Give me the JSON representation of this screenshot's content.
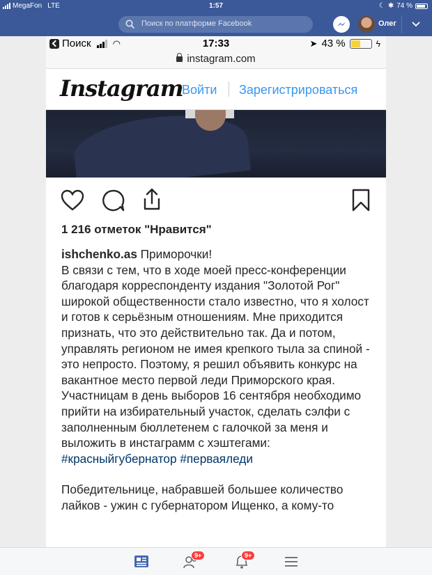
{
  "ipad_status": {
    "carrier": "MegaFon",
    "network": "LTE",
    "time": "1:57",
    "battery": "74 %"
  },
  "fb_bar": {
    "search_placeholder": "Поиск по платформе Facebook",
    "user_name": "Олег",
    "icons": [
      "search-icon",
      "messenger-icon",
      "avatar",
      "chevron-down-icon"
    ]
  },
  "phone_status": {
    "back_label": "Поиск",
    "time": "17:33",
    "battery": "43 %"
  },
  "browser": {
    "url": "instagram.com"
  },
  "instagram": {
    "logo": "Instagram",
    "login_label": "Войти",
    "signup_label": "Зарегистрироваться",
    "likes": "1 216 отметок \"Нравится\"",
    "username": "ishchenko.as",
    "caption_first": " Приморочки!",
    "caption_body": "В связи с тем, что в ходе моей пресс-конференции благодаря корреспонденту издания \"Золотой Рог\" широкой общественности стало известно, что я холост и готов к серьёзным отношениям. Мне приходится признать, что это действительно так. Да и потом, управлять регионом не имея крепкого тыла за спиной - это непросто. Поэтому, я решил объявить конкурс на вакантное место первой леди Приморского края. Участницам в день выборов 16 сентября необходимо прийти на избирательный участок, сделать сэлфи с заполненным бюллетенем с галочкой за меня и выложить в инстаграмм с хэштегами: ",
    "hashtag1": "#красныйгубернатор",
    "hashtag2": "#перваяледи",
    "caption_p2": "Победительнице, набравшей большее количество лайков - ужин с губернатором Ищенко, а кому-то"
  },
  "tabbar": {
    "friends_badge": "9+",
    "notifications_badge": "9+"
  },
  "colors": {
    "facebook_blue": "#3b5998",
    "instagram_link": "#3897f0",
    "hashtag": "#003569",
    "badge": "#fa3e3e"
  }
}
